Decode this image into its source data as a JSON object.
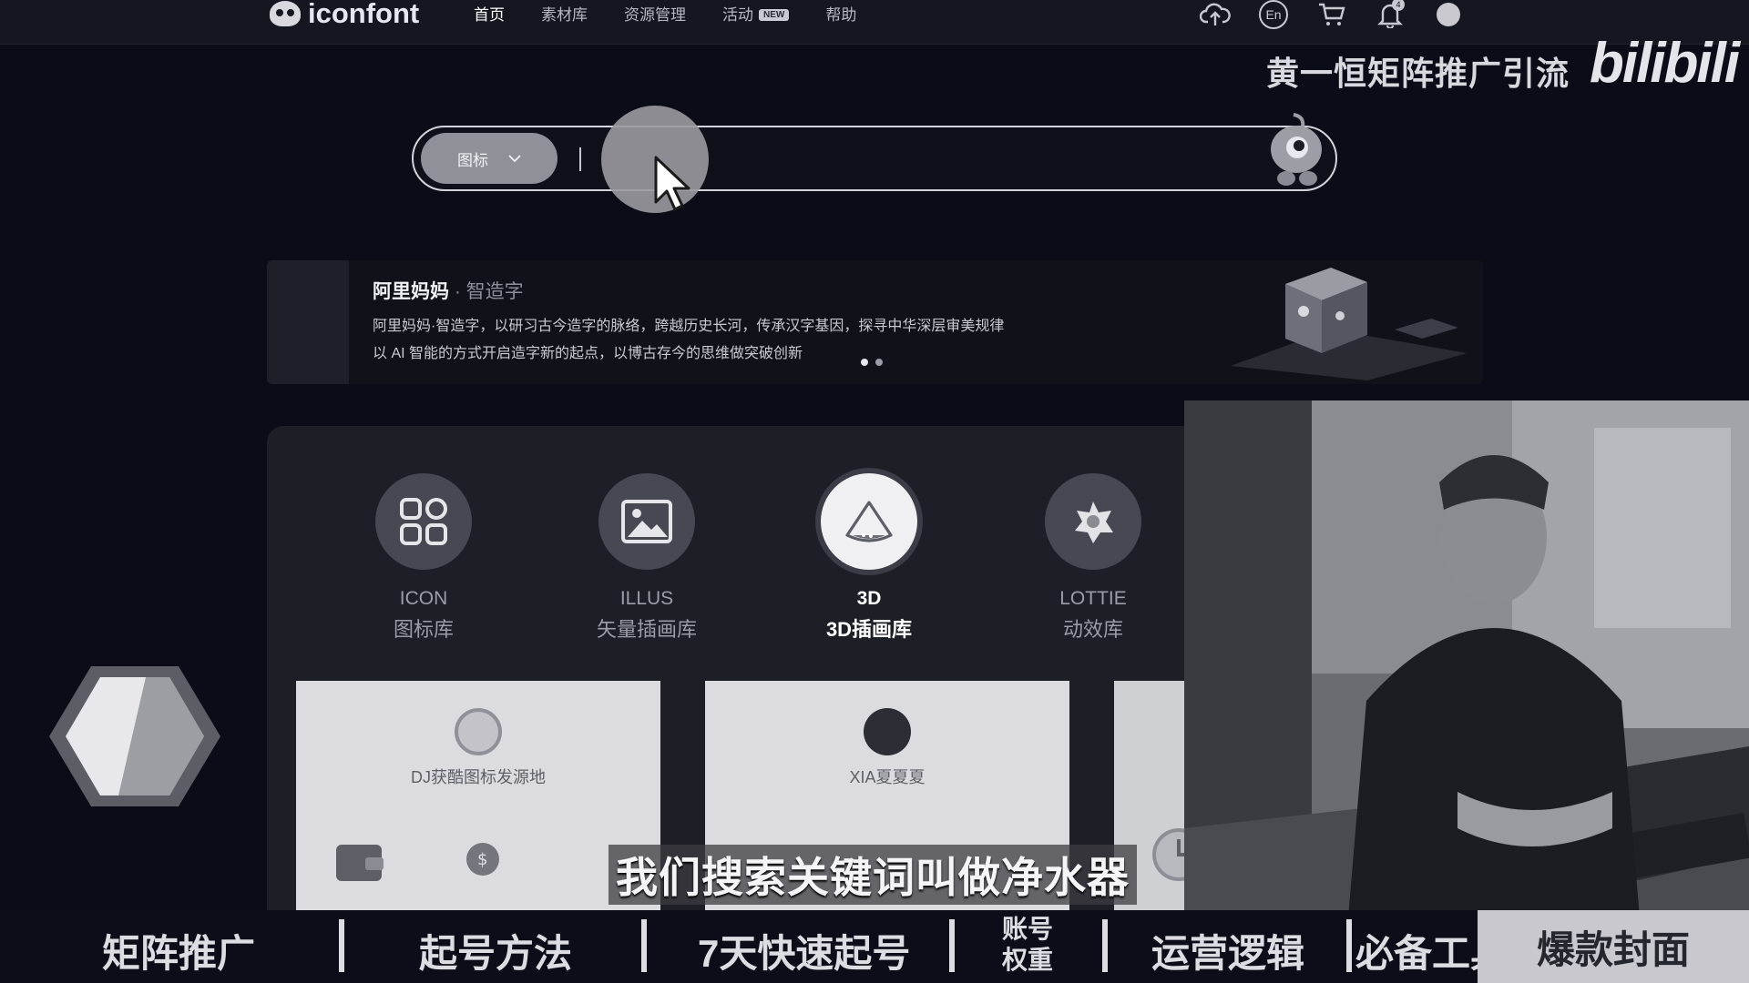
{
  "header": {
    "logo_text": "iconfont",
    "nav": [
      {
        "label": "首页",
        "active": true
      },
      {
        "label": "素材库",
        "active": false
      },
      {
        "label": "资源管理",
        "active": false
      },
      {
        "label": "活动",
        "active": false,
        "badge": "NEW"
      },
      {
        "label": "帮助",
        "active": false
      }
    ],
    "icons": [
      "upload-cloud-icon",
      "language-icon",
      "cart-icon",
      "bell-icon",
      "user-avatar"
    ],
    "language_label": "En",
    "notification_count": "4"
  },
  "watermark": {
    "text": "黄一恒矩阵推广引流",
    "logo": "bilibili"
  },
  "search": {
    "type_label": "图标",
    "value": ""
  },
  "banner": {
    "title": "阿里妈妈",
    "title_sub": " · 智造字",
    "line1": "阿里妈妈·智造字，以研习古今造字的脉络，跨越历史长河，传承汉字基因，探寻中华深层审美规律",
    "line2": "以 AI 智能的方式开启造字新的起点，以博古存今的思维做突破创新",
    "slides": 2,
    "active_slide": 0
  },
  "categories": [
    {
      "en": "ICON",
      "cn": "图标库",
      "icon": "grid-icon",
      "active": false
    },
    {
      "en": "ILLUS",
      "cn": "矢量插画库",
      "icon": "image-icon",
      "active": false
    },
    {
      "en": "3D",
      "cn": "3D插画库",
      "icon": "pyramid-3d-icon",
      "active": true
    },
    {
      "en": "LOTTIE",
      "cn": "动效库",
      "icon": "lottie-flower-icon",
      "active": false
    }
  ],
  "cards": [
    {
      "name": "DJ获酷图标发源地",
      "icon": "dj-logo-icon"
    },
    {
      "name": "XIA夏夏夏",
      "icon": "xia-avatar-icon"
    },
    {
      "name": "",
      "icon": "clock-icon"
    }
  ],
  "subtitle": "我们搜索关键词叫做净水器",
  "bottom_menu": {
    "items": [
      "矩阵推广",
      "起号方法",
      "7天快速起号",
      "运营逻辑",
      "必备工具"
    ],
    "small_line1": "账号",
    "small_line2": "权重",
    "highlight": "爆款封面"
  },
  "colors": {
    "background": "#0b0c18",
    "panel": "#1d1e26",
    "accent_light": "#f0f0f3"
  }
}
